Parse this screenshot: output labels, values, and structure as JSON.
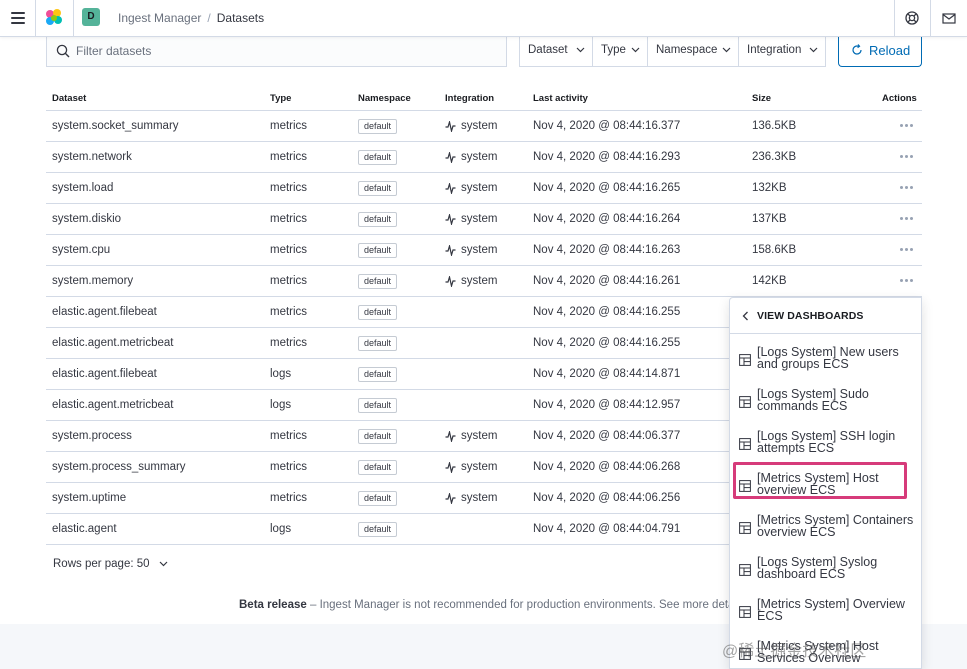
{
  "header": {
    "space_initial": "D",
    "breadcrumbs": [
      "Ingest Manager",
      "Datasets"
    ],
    "icons": [
      "menu-icon",
      "elastic-logo",
      "help-icon",
      "mail-icon"
    ]
  },
  "filters": {
    "search_placeholder": "Filter datasets",
    "search_value": "",
    "dataset_label": "Dataset",
    "type_label": "Type",
    "namespace_label": "Namespace",
    "integration_label": "Integration",
    "reload_label": "Reload"
  },
  "table": {
    "headers": {
      "dataset": "Dataset",
      "type": "Type",
      "namespace": "Namespace",
      "integration": "Integration",
      "activity": "Last activity",
      "size": "Size",
      "actions": "Actions"
    },
    "rows": [
      {
        "dataset": "system.socket_summary",
        "type": "metrics",
        "namespace": "default",
        "integration": "system",
        "activity": "Nov 4, 2020 @ 08:44:16.377",
        "size": "136.5KB"
      },
      {
        "dataset": "system.network",
        "type": "metrics",
        "namespace": "default",
        "integration": "system",
        "activity": "Nov 4, 2020 @ 08:44:16.293",
        "size": "236.3KB"
      },
      {
        "dataset": "system.load",
        "type": "metrics",
        "namespace": "default",
        "integration": "system",
        "activity": "Nov 4, 2020 @ 08:44:16.265",
        "size": "132KB"
      },
      {
        "dataset": "system.diskio",
        "type": "metrics",
        "namespace": "default",
        "integration": "system",
        "activity": "Nov 4, 2020 @ 08:44:16.264",
        "size": "137KB"
      },
      {
        "dataset": "system.cpu",
        "type": "metrics",
        "namespace": "default",
        "integration": "system",
        "activity": "Nov 4, 2020 @ 08:44:16.263",
        "size": "158.6KB"
      },
      {
        "dataset": "system.memory",
        "type": "metrics",
        "namespace": "default",
        "integration": "system",
        "activity": "Nov 4, 2020 @ 08:44:16.261",
        "size": "142KB"
      },
      {
        "dataset": "elastic.agent.filebeat",
        "type": "metrics",
        "namespace": "default",
        "integration": "",
        "activity": "Nov 4, 2020 @ 08:44:16.255",
        "size": ""
      },
      {
        "dataset": "elastic.agent.metricbeat",
        "type": "metrics",
        "namespace": "default",
        "integration": "",
        "activity": "Nov 4, 2020 @ 08:44:16.255",
        "size": ""
      },
      {
        "dataset": "elastic.agent.filebeat",
        "type": "logs",
        "namespace": "default",
        "integration": "",
        "activity": "Nov 4, 2020 @ 08:44:14.871",
        "size": ""
      },
      {
        "dataset": "elastic.agent.metricbeat",
        "type": "logs",
        "namespace": "default",
        "integration": "",
        "activity": "Nov 4, 2020 @ 08:44:12.957",
        "size": ""
      },
      {
        "dataset": "system.process",
        "type": "metrics",
        "namespace": "default",
        "integration": "system",
        "activity": "Nov 4, 2020 @ 08:44:06.377",
        "size": ""
      },
      {
        "dataset": "system.process_summary",
        "type": "metrics",
        "namespace": "default",
        "integration": "system",
        "activity": "Nov 4, 2020 @ 08:44:06.268",
        "size": ""
      },
      {
        "dataset": "system.uptime",
        "type": "metrics",
        "namespace": "default",
        "integration": "system",
        "activity": "Nov 4, 2020 @ 08:44:06.256",
        "size": ""
      },
      {
        "dataset": "elastic.agent",
        "type": "logs",
        "namespace": "default",
        "integration": "",
        "activity": "Nov 4, 2020 @ 08:44:04.791",
        "size": ""
      }
    ]
  },
  "pagination": {
    "label": "Rows per page: 50"
  },
  "footer": {
    "beta_label": "Beta release",
    "beta_text": " – Ingest Manager is not recommended for production environments. See more details."
  },
  "popover": {
    "title": "VIEW DASHBOARDS",
    "items": [
      "[Logs System] New users and groups ECS",
      "[Logs System] Sudo commands ECS",
      "[Logs System] SSH login attempts ECS",
      "[Metrics System] Host overview ECS",
      "[Metrics System] Containers overview ECS",
      "[Logs System] Syslog dashboard ECS",
      "[Metrics System] Overview ECS",
      "[Metrics System] Host Services Overview"
    ],
    "highlighted_index": 3
  },
  "watermark": "@稀土掘金技术社区",
  "colors": {
    "accent": "#006bb4",
    "highlight": "#d63b7a",
    "space_badge": "#54b399"
  }
}
